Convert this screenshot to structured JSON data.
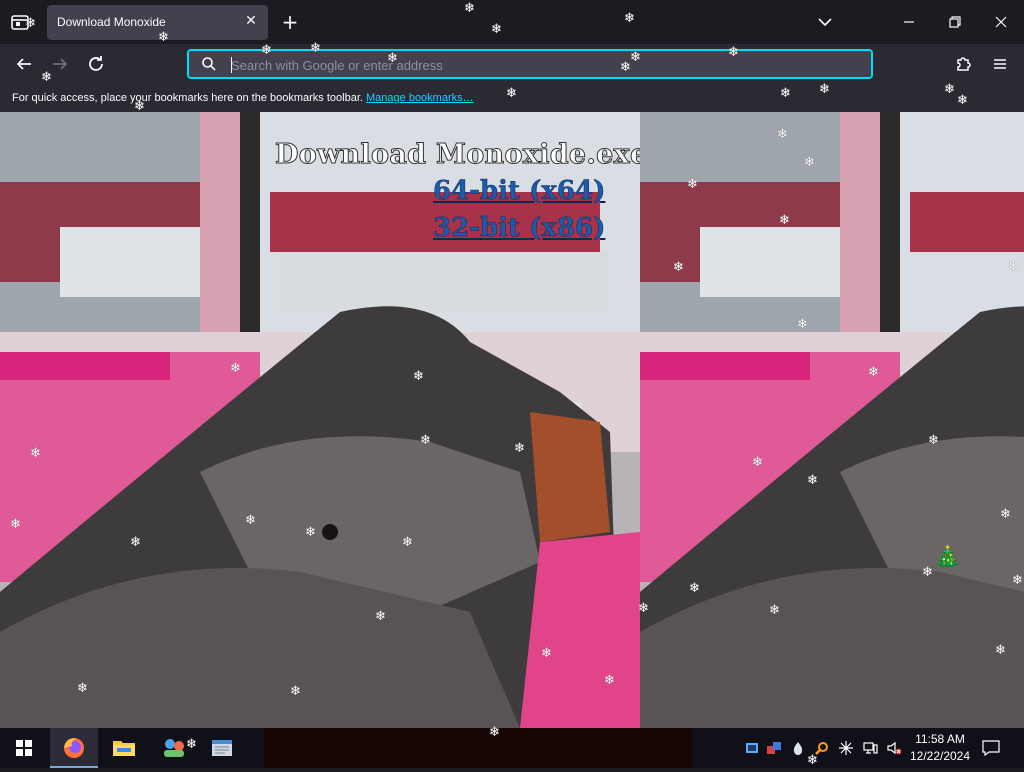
{
  "browser": {
    "tab_title": "Download Monoxide",
    "urlbar_placeholder": "Search with Google or enter address",
    "bookmarks_message": "For quick access, place your bookmarks here on the bookmarks toolbar.",
    "bookmarks_link": "Manage bookmarks…",
    "accent": "#00ddff"
  },
  "page": {
    "heading": "Download Monoxide.exe By Wipet",
    "links": [
      {
        "label": "64-bit (x64)"
      },
      {
        "label": "32-bit (x86)"
      }
    ],
    "link_color": "#1d5ba8"
  },
  "overlay": {
    "flake_glyph": "❄",
    "tree_glyph": "🎄"
  },
  "taskbar": {
    "pinned": [
      "firefox-icon",
      "file-explorer-icon",
      "people-app-icon",
      "notepad-icon"
    ],
    "tray": [
      "network-icon",
      "app-icon",
      "drop-icon",
      "search-icon",
      "sparkle-icon",
      "display-icon",
      "volume-muted-icon"
    ],
    "time": "11:58 AM",
    "date": "12/22/2024"
  }
}
